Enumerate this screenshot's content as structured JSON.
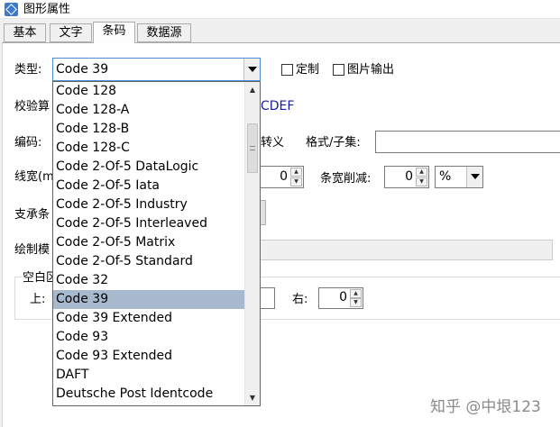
{
  "window": {
    "title": "图形属性"
  },
  "tabs": [
    {
      "label": "基本"
    },
    {
      "label": "文字"
    },
    {
      "label": "条码"
    },
    {
      "label": "数据源"
    }
  ],
  "form": {
    "type_label": "类型:",
    "type_value": "Code 39",
    "custom_checkbox": "定制",
    "image_output_checkbox": "图片输出",
    "check_digit_label": "校验算",
    "check_digit_value_tail": "CDEF",
    "encoding_label": "编码:",
    "escape_label": "转义",
    "format_label": "格式/子集:",
    "format_value": "",
    "line_width_label": "线宽(m",
    "line_width_value": "0",
    "bar_reduce_label": "条宽削减:",
    "bar_reduce_value": "0",
    "bar_reduce_unit": "%",
    "bearer_label": "支承条",
    "draw_mode_label": "绘制模",
    "quiet_zone_label": "空白区",
    "top_label": "上:",
    "top_value": "",
    "right_label": "右:",
    "right_value": "0"
  },
  "dropdown": {
    "options": [
      "Code 128",
      "Code 128-A",
      "Code 128-B",
      "Code 128-C",
      "Code 2-Of-5 DataLogic",
      "Code 2-Of-5 Iata",
      "Code 2-Of-5 Industry",
      "Code 2-Of-5 Interleaved",
      "Code 2-Of-5 Matrix",
      "Code 2-Of-5 Standard",
      "Code 32",
      "Code 39",
      "Code 39 Extended",
      "Code 93",
      "Code 93 Extended",
      "DAFT",
      "Deutsche Post Identcode"
    ],
    "selected_index": 11
  },
  "watermark": {
    "logo": "知乎",
    "handle": "@中垠123"
  },
  "icons": {
    "app": "app-icon",
    "combo": "chevron-down-icon",
    "spin_up": "spin-up-icon",
    "spin_down": "spin-down-icon",
    "scroll_up": "scroll-up-icon",
    "scroll_down": "scroll-down-icon"
  },
  "colors": {
    "selected_option": "#a7b9cc",
    "link_text": "#1a1aa6",
    "app_icon": "#3f79c9"
  }
}
